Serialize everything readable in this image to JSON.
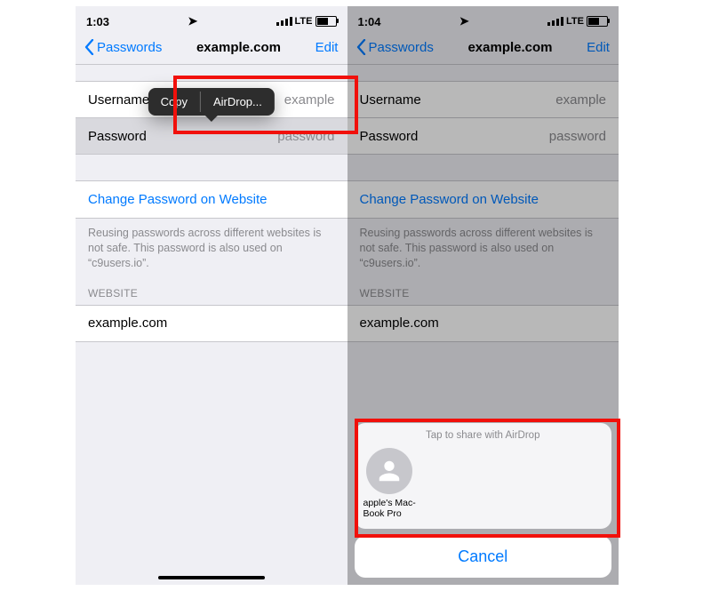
{
  "colors": {
    "blue": "#007aff",
    "highlight": "#f1100b"
  },
  "left": {
    "status": {
      "time": "1:03",
      "loc": "➤",
      "network": "LTE"
    },
    "nav": {
      "back": "Passwords",
      "title": "example.com",
      "edit": "Edit"
    },
    "rows": {
      "username": {
        "label": "Username",
        "value": "example"
      },
      "password": {
        "label": "Password",
        "value": "password"
      }
    },
    "change_link": "Change Password on Website",
    "reuse_warning": "Reusing passwords across different websites is not safe. This password is also used on “c9users.io”.",
    "section_head": "WEBSITE",
    "website": "example.com",
    "popover": {
      "copy": "Copy",
      "airdrop": "AirDrop..."
    }
  },
  "right": {
    "status": {
      "time": "1:04",
      "loc": "➤",
      "network": "LTE"
    },
    "nav": {
      "back": "Passwords",
      "title": "example.com",
      "edit": "Edit"
    },
    "rows": {
      "username": {
        "label": "Username",
        "value": "example"
      },
      "password": {
        "label": "Password",
        "value": "password"
      }
    },
    "change_link": "Change Password on Website",
    "reuse_warning": "Reusing passwords across different websites is not safe. This password is also used on “c9users.io”.",
    "section_head": "WEBSITE",
    "website": "example.com",
    "sheet": {
      "head": "Tap to share with AirDrop",
      "target_name": "apple's Mac-\nBook Pro",
      "cancel": "Cancel"
    }
  }
}
